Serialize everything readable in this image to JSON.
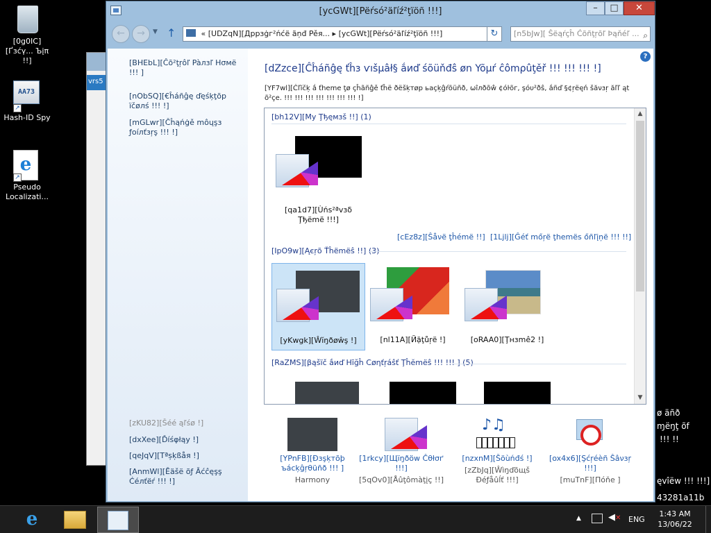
{
  "desktop": {
    "icons": [
      {
        "name": "recycle-bin",
        "label": "[0g0IC][Ґзćγ... Ъįπ !!]"
      },
      {
        "name": "hash-id-spy",
        "label": "Hash-ID Spy",
        "glyph": "AA73"
      },
      {
        "name": "pseudo-localization",
        "label": "Pseudo Localizati..."
      }
    ],
    "right_text": [
      "ø äñð",
      "ɱëŋţ õf",
      "!!! !!",
      "ęvîëw !!! !!!]",
      "43281a11b"
    ],
    "background_window_label": "vrs5"
  },
  "window": {
    "title": "[ycGWt][Pëŕsó²äľíź²ţïöñ !!!]",
    "controls": {
      "minimize": "–",
      "maximize": "□",
      "close": "✕"
    },
    "address": {
      "prefix": "«",
      "crumb1": "[UDZqN][Дррзġг²ńćë ãņđ Pěя...",
      "sep": "▸",
      "crumb2": "[ycGWt][Pëŕsó²äľíź²ţïöñ !!!]"
    },
    "search": {
      "placeholder": "[n5bJw][ Ŝëąŕçĥ Ċõñţŗõľ Þąňéľ ..."
    },
    "left_pane": {
      "home": "[BHEbL][Ĉõ²ţŗôľ Pàлзľ Нσмё !!! ]",
      "desktop_icons": "[nObSQ][€ĥáñĝę ďęśķţõр їčøлś !!! !]",
      "mouse_pointers": "[mGLwr][Čĥąńġě môųşз ƒoíлťзŗş !!! !]",
      "see_also": "[zKU82][Šéé ąľśø !]",
      "display": "[dxXee][Ďíśφłąу !]",
      "taskbar": "[qeJqV][Тªșķßåя !]",
      "ease_of_access": "[AnmWl][Ēäšё õƒ Āćĉęşş Ćéлťëŕ !!! !]"
    },
    "main": {
      "title": "[dZzce][Ĉĥáñĝę ťĥз ѵıšµâł§ ắиď śõüňđŝ øn Yõµŕ ĉômρûţěř !!! !!! !!! !]",
      "description": "[YF7wl][Ċľĭčķ ắ ťheme ţø çĥãñĝě ťĥё ðëšķтøр ьаçķĝŕõüñð, ωîлðõŵ ¢óŀõг, şóυ²ðŝ, ắñď §¢ŗëęń šăνзŗ ăľľ ąt õ²çe. !!! !!! !!! !!! !!! !!! !!! !]"
    },
    "groups": {
      "my_themes": {
        "label": "[bh12V][Му Ţђęмзš !!] (1)"
      },
      "aero_themes": {
        "label": "[IpO9w][Ąєŗõ Ťĥëmёŝ !!] (3)"
      },
      "basic_themes": {
        "label": "[RaZMS][βąšïč ắиď Нīğĥ Сøηťŗáŝť Ţĥĕmёŝ !!! !!! ] (5)"
      }
    },
    "tiles": {
      "unsaved": "[qa1d7][Ùńs²ªvзδ Ţђёmë !!!]",
      "windows": "[yKwgk][Ŵĭŋðøŵş !]",
      "flowers": "[nl11A][Йặţůŗë !]",
      "landscapes": "[oRAA0][Ţнзmê2 !]"
    },
    "links": {
      "save_theme": "[cEz8z][Ŝåνë ţĥémë !!]",
      "get_more": "[1Ljlj][Ĝéť mőŗë ţhemës őñľįņë !!! !!]"
    },
    "bottom": {
      "background": {
        "link": "[YPnFB][Ðзşķтõþ ъácķĝŗθüñð !!! ]",
        "sub": "Harmony"
      },
      "color": {
        "link": "[1rkcy][Щїŋðöw Ĉθłσґ !!!]",
        "sub": "[5qOv0][Åûţômàţįç !!]"
      },
      "sounds": {
        "link": "[nzxnM][Šöùńđś !]",
        "sub": "[zZbJq][Ŵìŋďõщš Ðéƒåûĺť !!!]"
      },
      "saver": {
        "link": "[ox4x6][Şćŗéèñ Ŝâνзŗ !!!]",
        "sub": "[muTnF][Пóňе ]"
      }
    }
  },
  "taskbar": {
    "language": "ENG",
    "time": "1:43 AM",
    "date": "13/06/22"
  }
}
